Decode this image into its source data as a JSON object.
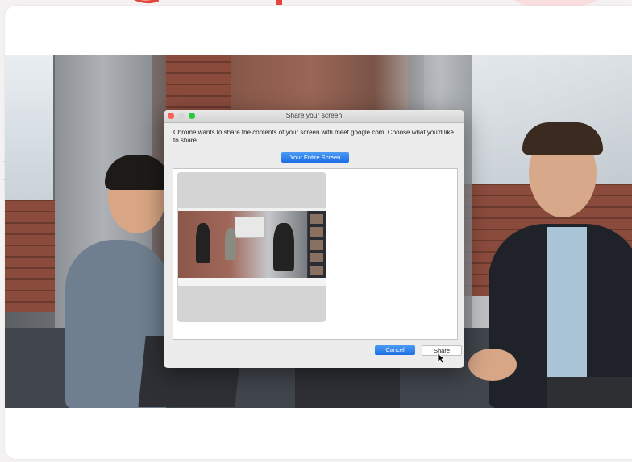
{
  "dialog": {
    "title": "Share your screen",
    "message": "Chrome wants to share the contents of your screen with meet.google.com. Choose what you'd like to share.",
    "tab_label": "Your Entire Screen",
    "cancel_label": "Cancel",
    "share_label": "Share",
    "window_controls": [
      "close-icon",
      "minimize-icon",
      "maximize-icon"
    ]
  },
  "colors": {
    "accent_blue": "#1e6fe4",
    "close_red": "#fc5f57",
    "maximize_green": "#2ac840",
    "decor_red": "#e5443a",
    "card_bg": "#ffffff"
  },
  "icons": {
    "cursor": "mouse-pointer-icon"
  }
}
